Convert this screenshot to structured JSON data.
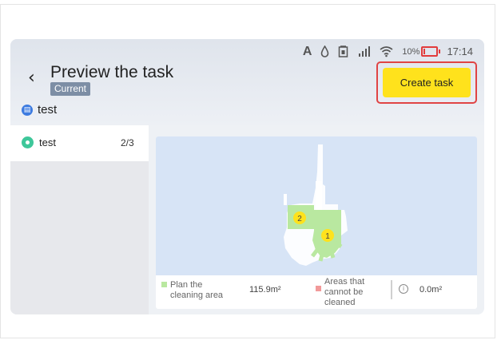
{
  "status_bar": {
    "font_icon": "A",
    "battery_percent": "10%",
    "battery_level": 0.1,
    "time": "17:14",
    "icons": [
      "font-icon",
      "water-drop-icon",
      "sim-card-icon",
      "cellular-signal-icon",
      "wifi-icon",
      "battery-low-icon"
    ],
    "accent_battery_color": "#e23b3b"
  },
  "header": {
    "back_icon": "chevron-left-icon",
    "title": "Preview the task",
    "badge": "Current",
    "create_button_label": "Create task",
    "create_button_color": "#ffe21c",
    "highlight_color": "#e04444"
  },
  "map_selector": {
    "icon": "map-icon",
    "name": "test"
  },
  "sidebar": {
    "items": [
      {
        "label": "test",
        "count": "2/3",
        "icon": "location-pin-icon",
        "icon_color": "#3ec79a"
      }
    ]
  },
  "map": {
    "room_markers": [
      "2",
      "1"
    ],
    "background_color": "#d7e4f6",
    "plan_color": "#b9e8a0",
    "marker_color": "#ffe21c"
  },
  "legend": {
    "plan_label": "Plan the cleaning area",
    "plan_value_num": "115.9",
    "plan_value_unit": "m²",
    "no_clean_label": "Areas that cannot be cleaned",
    "info_icon": "info-icon",
    "no_clean_value_num": "0.0",
    "no_clean_value_unit": "m²"
  }
}
